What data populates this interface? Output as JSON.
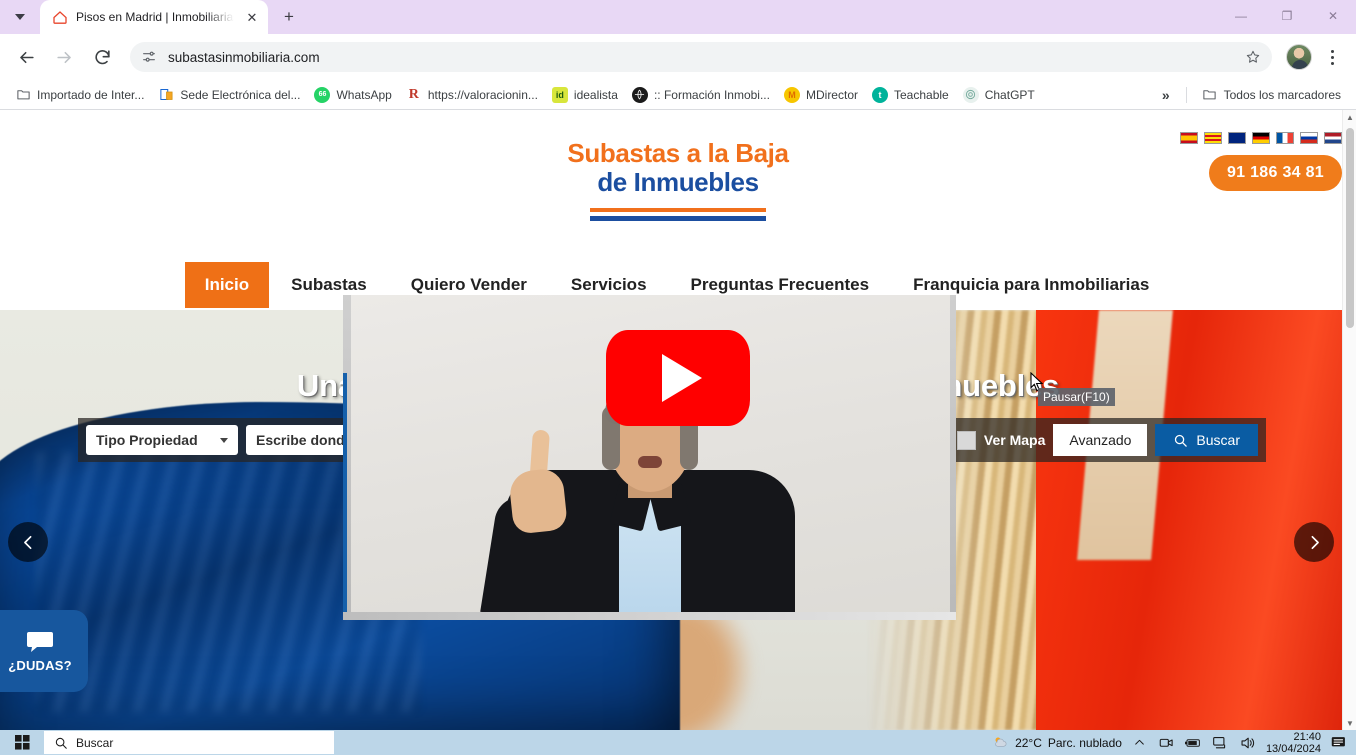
{
  "browser": {
    "tab": {
      "title": "Pisos en Madrid | Inmobiliarias",
      "close_label": "✕",
      "favicon_name": "house-icon"
    },
    "new_tab_label": "+",
    "window_controls": {
      "minimize": "—",
      "maximize": "❐",
      "close": "✕"
    },
    "omnibox": {
      "url": "subastasinmobiliaria.com",
      "site_info_icon": "tune-icon",
      "star_icon": "star-icon"
    },
    "nav": {
      "back": "back-arrow",
      "forward": "forward-arrow",
      "reload": "reload-icon"
    },
    "profile": "avatar",
    "menu": "kebab-menu",
    "bookmarks": [
      {
        "label": "Importado de Inter...",
        "icon": "folder",
        "color": "#5f6368"
      },
      {
        "label": "Sede Electrónica del...",
        "icon": "doc",
        "color": "#1967d2"
      },
      {
        "label": "WhatsApp",
        "icon": "badge",
        "color": "#25d366",
        "badge": "66"
      },
      {
        "label": "https://valoracionin...",
        "icon": "r-mark",
        "color": "#c0392b"
      },
      {
        "label": "idealista",
        "icon": "id",
        "color": "#cddc39"
      },
      {
        "label": ":: Formación Inmobi...",
        "icon": "globe",
        "color": "#202124"
      },
      {
        "label": "MDirector",
        "icon": "m-circle",
        "color": "#f7c600"
      },
      {
        "label": "Teachable",
        "icon": "t-circle",
        "color": "#00b39b"
      },
      {
        "label": "ChatGPT",
        "icon": "chatgpt",
        "color": "#74aa9c"
      }
    ],
    "bookmarks_overflow": "»",
    "all_bookmarks": {
      "label": "Todos los marcadores",
      "icon": "folder-icon"
    }
  },
  "site": {
    "logo": {
      "line1": "Subastas a la Baja",
      "line2": "de Inmuebles",
      "color1": "#f1701c",
      "color2": "#1b4ea0"
    },
    "phone": "91 186 34 81",
    "phone_color": "#f07c1b",
    "languages": [
      {
        "name": "espanol",
        "colors": [
          "#c60b1e",
          "#ffc400",
          "#c60b1e"
        ]
      },
      {
        "name": "catalan",
        "colors": [
          "#fcdd09",
          "#da121a",
          "#fcdd09"
        ]
      },
      {
        "name": "english",
        "colors": [
          "#00247d",
          "#ffffff",
          "#cf142b"
        ]
      },
      {
        "name": "deutsch",
        "colors": [
          "#000000",
          "#dd0000",
          "#ffce00"
        ]
      },
      {
        "name": "francais",
        "colors": [
          "#0055a4",
          "#ffffff",
          "#ef4135"
        ]
      },
      {
        "name": "russian",
        "colors": [
          "#ffffff",
          "#0039a6",
          "#d52b1e"
        ]
      },
      {
        "name": "nederlands",
        "colors": [
          "#ae1c28",
          "#ffffff",
          "#21468b"
        ]
      }
    ],
    "nav": [
      {
        "label": "Inicio",
        "active": true
      },
      {
        "label": "Subastas",
        "active": false
      },
      {
        "label": "Quiero Vender",
        "active": false
      },
      {
        "label": "Servicios",
        "active": false
      },
      {
        "label": "Preguntas Frecuentes",
        "active": false
      },
      {
        "label": "Franquicia para Inmobiliarias",
        "active": false
      }
    ],
    "nav_active_color": "#ef7016",
    "hero": {
      "title": "Una nueva forma de comprar y de vender Inmuebles",
      "search": {
        "property_type": "Tipo Propiedad",
        "location_placeholder": "Escribe donde",
        "map_checkbox_label": "Ver Mapa",
        "advanced_label": "Avanzado",
        "search_label": "Buscar",
        "search_button_color": "#0a5ca3"
      },
      "prev_arrow": "‹",
      "next_arrow": "›"
    },
    "chat_widget": {
      "label": "¿DUDAS?",
      "icon": "chat-bubble-icon",
      "color": "#17579e"
    }
  },
  "video_overlay": {
    "play_button": "youtube-play-button",
    "play_color": "#ff0000",
    "tooltip": "Pausar(F10)"
  },
  "taskbar": {
    "start": "windows-logo",
    "search_placeholder": "Buscar",
    "weather": {
      "temp": "22°C",
      "condition": "Parc. nublado"
    },
    "tray": [
      "chevron-up-icon",
      "camera-icon",
      "battery-icon",
      "network-icon",
      "volume-icon"
    ],
    "clock": {
      "time": "21:40",
      "date": "13/04/2024"
    },
    "notifications": "notification-icon"
  }
}
